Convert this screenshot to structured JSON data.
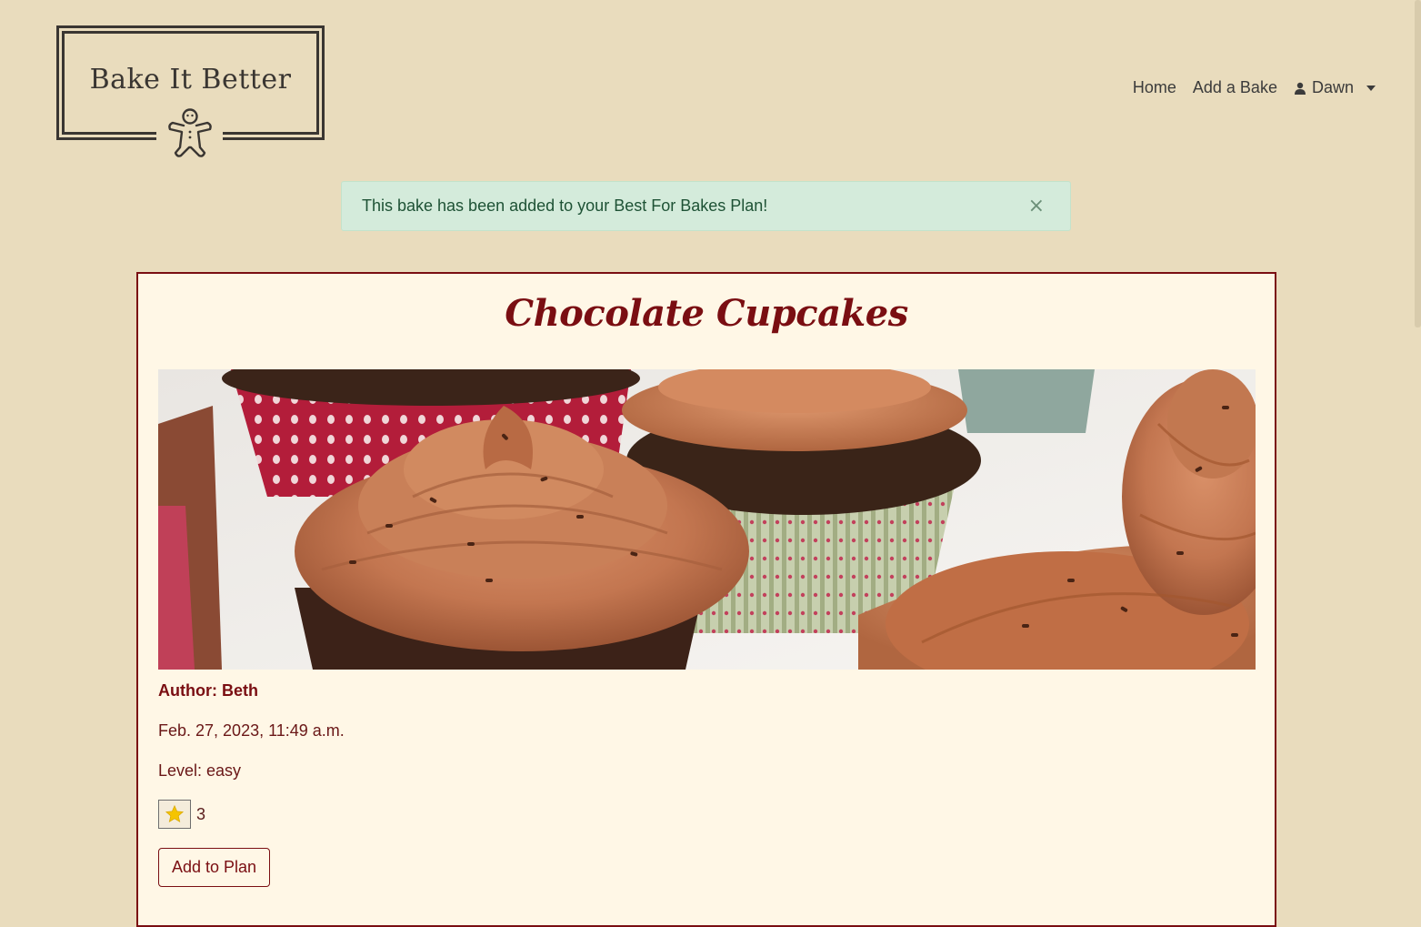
{
  "header": {
    "logo_text": "Bake It Better",
    "nav": {
      "home": "Home",
      "add_bake": "Add a Bake",
      "user": "Dawn"
    }
  },
  "alert": {
    "message": "This bake has been added to your Best For Bakes Plan!",
    "close_symbol": "×"
  },
  "bake": {
    "title": "Chocolate Cupcakes",
    "author": "Author: Beth",
    "date": "Feb. 27, 2023, 11:49 a.m.",
    "level": "Level: easy",
    "rating_count": "3",
    "add_to_plan_label": "Add to Plan"
  },
  "icons": {
    "logo": "gingerbread-man-icon",
    "user": "user-icon",
    "star": "star-icon",
    "close": "close-icon"
  },
  "colors": {
    "page_bg": "#e9dcbd",
    "card_bg": "#fff7e6",
    "accent": "#7a0e12",
    "alert_bg": "#d4ebdb",
    "star": "#f5c400"
  }
}
